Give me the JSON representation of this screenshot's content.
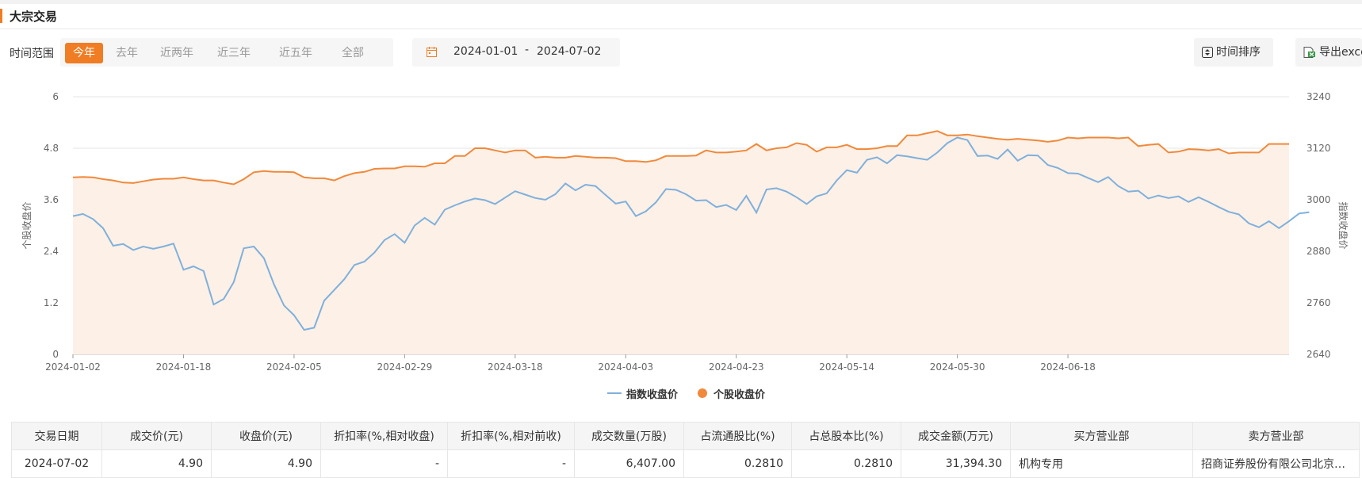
{
  "header": {
    "title": "大宗交易"
  },
  "filters": {
    "range_label": "时间范围",
    "ranges": [
      "今年",
      "去年",
      "近两年",
      "近三年",
      "近五年",
      "全部"
    ],
    "active_range": "今年",
    "date_start": "2024-01-01",
    "date_sep": "-",
    "date_end": "2024-07-02",
    "sort_label": "时间排序",
    "export_label": "导出excel"
  },
  "chart_data": {
    "type": "line",
    "title": "",
    "ylabel_left": "个股收盘价",
    "ylabel_right": "指数收盘价",
    "ylim_left": [
      0,
      6
    ],
    "yticks_left": [
      "0",
      "1.2",
      "2.4",
      "3.6",
      "4.8",
      "6"
    ],
    "ylim_right": [
      2640,
      3240
    ],
    "yticks_right": [
      "2640",
      "2760",
      "2880",
      "3000",
      "3120",
      "3240"
    ],
    "x_tick_labels": [
      "2024-01-02",
      "2024-01-18",
      "2024-02-05",
      "2024-02-29",
      "2024-03-18",
      "2024-04-03",
      "2024-04-23",
      "2024-05-14",
      "2024-05-30",
      "2024-06-18"
    ],
    "legend": {
      "placement": "bottom-center"
    },
    "colors": {
      "index": "#7fb0dc",
      "stock": "#f0893b",
      "area": "#fdf0e6"
    },
    "series": [
      {
        "name": "指数收盘价",
        "axis": "right",
        "values": [
          2962,
          2967,
          2955,
          2934,
          2893,
          2897,
          2883,
          2891,
          2886,
          2891,
          2898,
          2837,
          2845,
          2834,
          2756,
          2769,
          2808,
          2887,
          2891,
          2864,
          2803,
          2754,
          2731,
          2697,
          2702,
          2765,
          2790,
          2815,
          2848,
          2856,
          2877,
          2906,
          2920,
          2900,
          2940,
          2958,
          2942,
          2977,
          2987,
          2996,
          3003,
          2999,
          2990,
          3005,
          3020,
          3012,
          3004,
          3000,
          3013,
          3038,
          3022,
          3035,
          3032,
          3011,
          2991,
          2996,
          2962,
          2973,
          2994,
          3025,
          3023,
          3013,
          2998,
          2999,
          2983,
          2988,
          2976,
          3009,
          2970,
          3024,
          3027,
          3019,
          3006,
          2990,
          3008,
          3015,
          3045,
          3069,
          3063,
          3093,
          3099,
          3085,
          3104,
          3101,
          3097,
          3093,
          3110,
          3132,
          3145,
          3139,
          3102,
          3103,
          3095,
          3117,
          3091,
          3104,
          3103,
          3081,
          3074,
          3062,
          3061,
          3051,
          3041,
          3053,
          3032,
          3019,
          3021,
          3003,
          3010,
          3004,
          3008,
          2995,
          3006,
          2995,
          2983,
          2972,
          2966,
          2945,
          2936,
          2950,
          2934,
          2950,
          2968,
          2971
        ]
      },
      {
        "name": "个股收盘价",
        "axis": "left",
        "values": [
          4.12,
          4.13,
          4.12,
          4.08,
          4.05,
          4.0,
          3.99,
          4.03,
          4.07,
          4.09,
          4.09,
          4.12,
          4.08,
          4.05,
          4.05,
          4.0,
          3.96,
          4.08,
          4.24,
          4.27,
          4.25,
          4.25,
          4.24,
          4.12,
          4.1,
          4.1,
          4.05,
          4.15,
          4.22,
          4.25,
          4.32,
          4.33,
          4.33,
          4.38,
          4.38,
          4.37,
          4.45,
          4.45,
          4.62,
          4.62,
          4.8,
          4.8,
          4.75,
          4.7,
          4.75,
          4.75,
          4.58,
          4.6,
          4.58,
          4.58,
          4.62,
          4.6,
          4.58,
          4.58,
          4.57,
          4.5,
          4.5,
          4.48,
          4.52,
          4.62,
          4.62,
          4.62,
          4.63,
          4.75,
          4.7,
          4.7,
          4.72,
          4.75,
          4.9,
          4.75,
          4.8,
          4.82,
          4.92,
          4.88,
          4.72,
          4.82,
          4.82,
          4.88,
          4.78,
          4.78,
          4.8,
          4.85,
          4.85,
          5.1,
          5.1,
          5.15,
          5.2,
          5.1,
          5.1,
          5.12,
          5.08,
          5.05,
          5.02,
          5.0,
          5.02,
          5.0,
          4.98,
          4.95,
          4.98,
          5.05,
          5.03,
          5.05,
          5.05,
          5.05,
          5.03,
          5.05,
          4.85,
          4.88,
          4.9,
          4.7,
          4.72,
          4.78,
          4.77,
          4.75,
          4.78,
          4.68,
          4.7,
          4.7,
          4.7,
          4.9,
          4.9,
          4.9
        ]
      }
    ]
  },
  "table": {
    "headers": [
      "交易日期",
      "成交价(元)",
      "收盘价(元)",
      "折扣率(%,相对收盘)",
      "折扣率(%,相对前收)",
      "成交数量(万股)",
      "占流通股比(%)",
      "占总股本比(%)",
      "成交金额(万元)",
      "买方营业部",
      "卖方营业部"
    ],
    "rows": [
      [
        "2024-07-02",
        "4.90",
        "4.90",
        "-",
        "-",
        "6,407.00",
        "0.2810",
        "0.2810",
        "31,394.30",
        "机构专用",
        "招商证券股份有限公司北京…"
      ]
    ]
  }
}
